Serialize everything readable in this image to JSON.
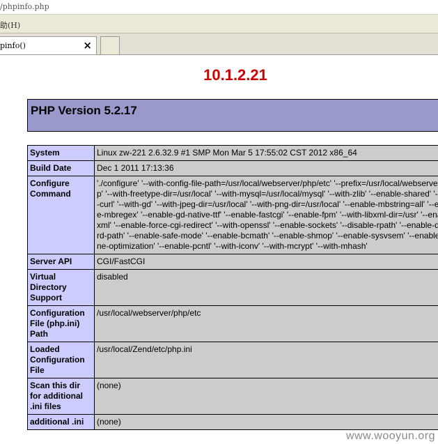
{
  "browser": {
    "url": "/phpinfo.php",
    "menu_label": "助(H)",
    "tab_label": "pinfo()",
    "tab_close": "×"
  },
  "page": {
    "ip_title": "10.1.2.21",
    "php_version_title": "PHP Version 5.2.17",
    "rows": [
      {
        "key": "System",
        "value": "Linux zw-221 2.6.32.9 #1 SMP Mon Mar 5 17:55:02 CST 2012 x86_64"
      },
      {
        "key": "Build Date",
        "value": "Dec 1 2011 17:13:36"
      },
      {
        "key": "Configure Command",
        "value": "'./configure' '--with-config-file-path=/usr/local/webserver/php/etc' '--prefix=/usr/local/webserver/php' '--with-freetype-dir=/usr/local' '--with-mysql=/usr/local/mysql' '--with-zlib' '--enable-shared' '--with-curl' '--with-gd' '--with-jpeg-dir=/usr/local' '--with-png-dir=/usr/local' '--enable-mbstring=all' '--enable-mbregex' '--enable-gd-native-ttf' '--enable-fastcgi' '--enable-fpm' '--with-libxml-dir=/usr' '--enable-xml' '--enable-force-cgi-redirect' '--with-openssl' '--enable-sockets' '--disable-rpath' '--enable-discard-path' '--enable-safe-mode' '--enable-bcmath' '--enable-shmop' '--enable-sysvsem' '--enable-inline-optimization' '--enable-pcntl' '--with-iconv' '--with-mcrypt' '--with-mhash'"
      },
      {
        "key": "Server API",
        "value": "CGI/FastCGI"
      },
      {
        "key": "Virtual Directory Support",
        "value": "disabled"
      },
      {
        "key": "Configuration File (php.ini) Path",
        "value": "/usr/local/webserver/php/etc"
      },
      {
        "key": "Loaded Configuration File",
        "value": "/usr/local/Zend/etc/php.ini"
      },
      {
        "key": "Scan this dir for additional .ini files",
        "value": "(none)"
      },
      {
        "key": "additional .ini",
        "value": "(none)"
      }
    ]
  },
  "watermark": "www.wooyun.org",
  "colors": {
    "ip_title": "#cc0000",
    "header_bg": "#9999cc",
    "key_cell_bg": "#ccccff",
    "value_cell_bg": "#cccccc"
  }
}
